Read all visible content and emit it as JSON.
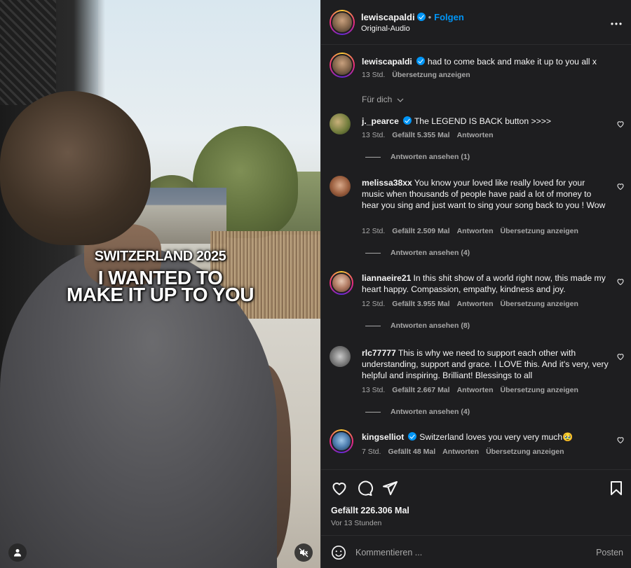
{
  "media": {
    "overlay_line1": "SWITZERLAND 2025",
    "overlay_line2": "I WANTED TO",
    "overlay_line3": "MAKE IT UP TO YOU",
    "user_icon": "user-icon",
    "mute_icon": "speaker-muted-icon"
  },
  "header": {
    "username": "lewiscapaldi",
    "verified": true,
    "separator": "•",
    "follow_label": "Folgen",
    "audio_label": "Original-Audio",
    "more_icon": "more-dots-icon"
  },
  "caption": {
    "username": "lewiscapaldi",
    "text": "had to come back and make it up to you all x",
    "time": "13 Std.",
    "translate": "Übersetzung anzeigen"
  },
  "filter_label": "Für dich",
  "comments": [
    {
      "username": "j._pearce",
      "verified": true,
      "text": "The LEGEND IS BACK button >>>>",
      "time": "13 Std.",
      "likes": "Gefällt 5.355 Mal",
      "reply": "Antworten",
      "translate": "",
      "replies": "Antworten ansehen (1)"
    },
    {
      "username": "melissa38xx",
      "verified": false,
      "text": "You know your loved like really loved for your music when thousands of people have paid a lot of money to hear you sing and just want to sing your song back to you ! Wow",
      "time": "12 Std.",
      "likes": "Gefällt 2.509 Mal",
      "reply": "Antworten",
      "translate": "Übersetzung anzeigen",
      "replies": "Antworten ansehen (4)"
    },
    {
      "username": "liannaeire21",
      "verified": false,
      "text": "In this shit show of a world right now, this made my heart happy. Compassion, empathy, kindness and joy.",
      "time": "12 Std.",
      "likes": "Gefällt 3.955 Mal",
      "reply": "Antworten",
      "translate": "Übersetzung anzeigen",
      "replies": "Antworten ansehen (8)"
    },
    {
      "username": "rlc77777",
      "verified": false,
      "text": "This is why we need to support each other with understanding, support and grace. I LOVE this. And it's very, very helpful and inspiring. Brilliant! Blessings to all",
      "time": "13 Std.",
      "likes": "Gefällt 2.667 Mal",
      "reply": "Antworten",
      "translate": "Übersetzung anzeigen",
      "replies": "Antworten ansehen (4)"
    },
    {
      "username": "kingselliot",
      "verified": true,
      "text": "Switzerland loves you very very much🥹",
      "time": "7 Std.",
      "likes": "Gefällt 48 Mal",
      "reply": "Antworten",
      "translate": "Übersetzung anzeigen",
      "replies": ""
    }
  ],
  "actions": {
    "like_icon": "heart-icon",
    "comment_icon": "comment-bubble-icon",
    "share_icon": "paper-plane-icon",
    "save_icon": "bookmark-icon",
    "likes_text": "Gefällt 226.306 Mal",
    "ago_text": "Vor 13 Stunden"
  },
  "composer": {
    "emoji_icon": "emoji-icon",
    "placeholder": "Kommentieren ...",
    "post_label": "Posten"
  },
  "colors": {
    "panel_bg": "#1e1e20",
    "link_blue": "#0095f6",
    "muted_text": "#a8a8a8"
  }
}
